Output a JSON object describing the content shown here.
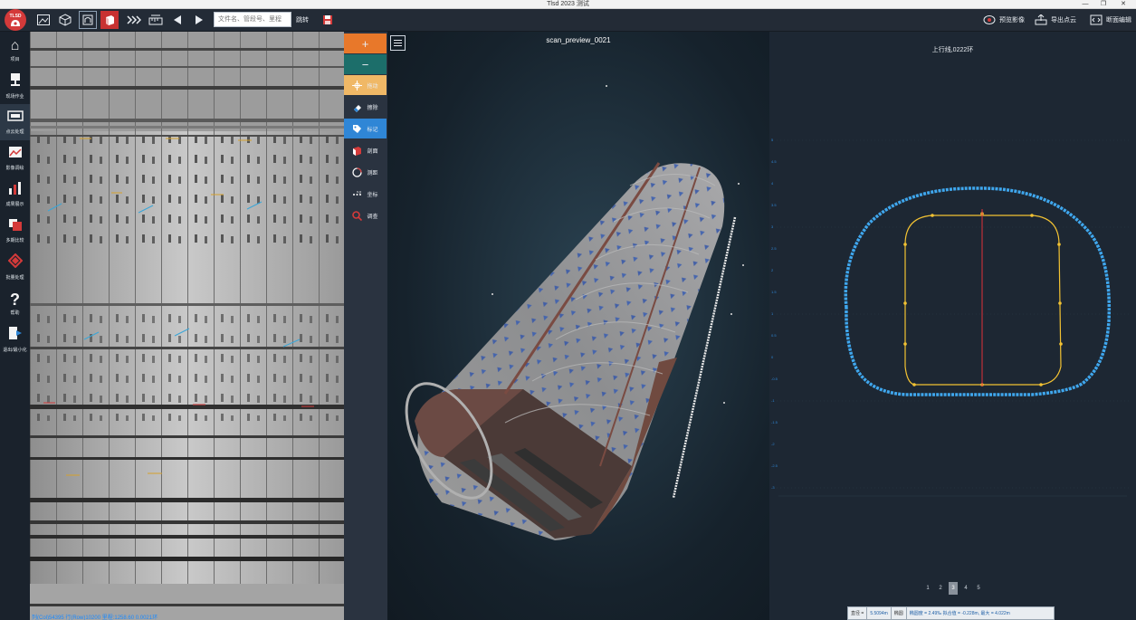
{
  "window": {
    "title": "Tlsd 2023  测试",
    "minimize": "—",
    "restore": "❐",
    "close": "✕"
  },
  "logo": {
    "text": "TLSD"
  },
  "toolbar": {
    "search_placeholder": "文件名、管段号、里程",
    "search_label": "跳转",
    "actions": [
      {
        "label": "预览影像",
        "icon": "eye-icon"
      },
      {
        "label": "导出点云",
        "icon": "export-icon"
      },
      {
        "label": "断面编辑",
        "icon": "code-icon"
      }
    ]
  },
  "sidebar": {
    "items": [
      {
        "label": "项目",
        "icon": "home-icon"
      },
      {
        "label": "现场作业",
        "icon": "scanner-icon"
      },
      {
        "label": "点云处理",
        "icon": "pointcloud-icon"
      },
      {
        "label": "影像调绘",
        "icon": "image-icon"
      },
      {
        "label": "成果展示",
        "icon": "chart-icon"
      },
      {
        "label": "多期比较",
        "icon": "compare-icon"
      },
      {
        "label": "批量处理",
        "icon": "batch-icon"
      },
      {
        "label": "帮助",
        "icon": "help-icon"
      },
      {
        "label": "退出/最小化",
        "icon": "exit-icon"
      }
    ],
    "active_index": 2
  },
  "panorama": {
    "status": "列(Col)54395   行(Row)10200   里程:1258.60   0.0021环"
  },
  "tools": {
    "plus": "+",
    "minus": "−",
    "items": [
      {
        "label": "拖动",
        "icon": "move-icon"
      },
      {
        "label": "擦除",
        "icon": "eraser-icon"
      },
      {
        "label": "标记",
        "icon": "tag-icon"
      },
      {
        "label": "剖面",
        "icon": "cube-icon"
      },
      {
        "label": "测距",
        "icon": "circle-icon"
      },
      {
        "label": "坐标",
        "icon": "coord-icon"
      },
      {
        "label": "调查",
        "icon": "magnify-icon"
      }
    ]
  },
  "view3d": {
    "title": "scan_preview_0021"
  },
  "section": {
    "title": "上行线,0222环",
    "pages": [
      "1",
      "2",
      "3",
      "4",
      "5"
    ],
    "active_page": "3",
    "info": {
      "diameter_label": "直径 =",
      "diameter_value": "5.5094m",
      "ellipse_label": "椭圆",
      "ellipse_value": "椭圆度 = 2.49‰ 拟合值 = -0.228m, 最大 = 4.022m"
    }
  },
  "colors": {
    "accent": "#c83232",
    "plus": "#e8782a",
    "minus": "#1c6e6a",
    "move": "#f0b866",
    "tag": "#2f86d6",
    "profile_outer": "#3fa7ee",
    "profile_inner": "#f2c233",
    "centerline": "#e0303a"
  }
}
